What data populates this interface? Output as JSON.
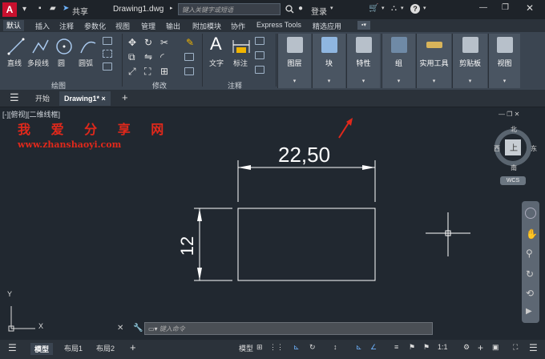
{
  "title_bar": {
    "app_logo": "A",
    "share": "共享",
    "document_title": "Drawing1.dwg",
    "search_placeholder": "键入关键字或短语",
    "login": "登录"
  },
  "ribbon_tabs": [
    "默认",
    "插入",
    "注释",
    "参数化",
    "视图",
    "管理",
    "输出",
    "附加模块",
    "协作",
    "Express Tools",
    "精选应用"
  ],
  "ribbon": {
    "draw_tools": [
      "直线",
      "多段线",
      "圆",
      "圆弧"
    ],
    "draw_panel": "绘图",
    "modify_panel": "修改",
    "annotation_tools": [
      "文字",
      "标注"
    ],
    "annotation_panel": "注释",
    "big_buttons": [
      "图层",
      "块",
      "特性",
      "组",
      "实用工具",
      "剪贴板",
      "视图"
    ]
  },
  "file_tabs": {
    "start": "开始",
    "drawing": "Drawing1*",
    "close": "×",
    "add": "+"
  },
  "viewport": {
    "label": "[-][俯视][二维线框]",
    "watermark_title": "我 爱 分 享 网",
    "watermark_url": "www.zhanshaoyi.com",
    "dim_horizontal": "22,50",
    "dim_vertical": "12",
    "viewcube": {
      "top": "上",
      "north": "北",
      "south": "南",
      "east": "东",
      "west": "西",
      "wcs": "WCS"
    },
    "ucs": {
      "x": "X",
      "y": "Y"
    }
  },
  "command_line": {
    "placeholder": "键入命令"
  },
  "status_bar": {
    "tabs": [
      "模型",
      "布局1",
      "布局2"
    ],
    "model_label": "模型",
    "scale": "1:1"
  },
  "colors": {
    "background": "#212830",
    "ribbon": "#3b4551",
    "accent_red": "#c8102e",
    "watermark": "#e0281b",
    "line_white": "#ffffff"
  }
}
